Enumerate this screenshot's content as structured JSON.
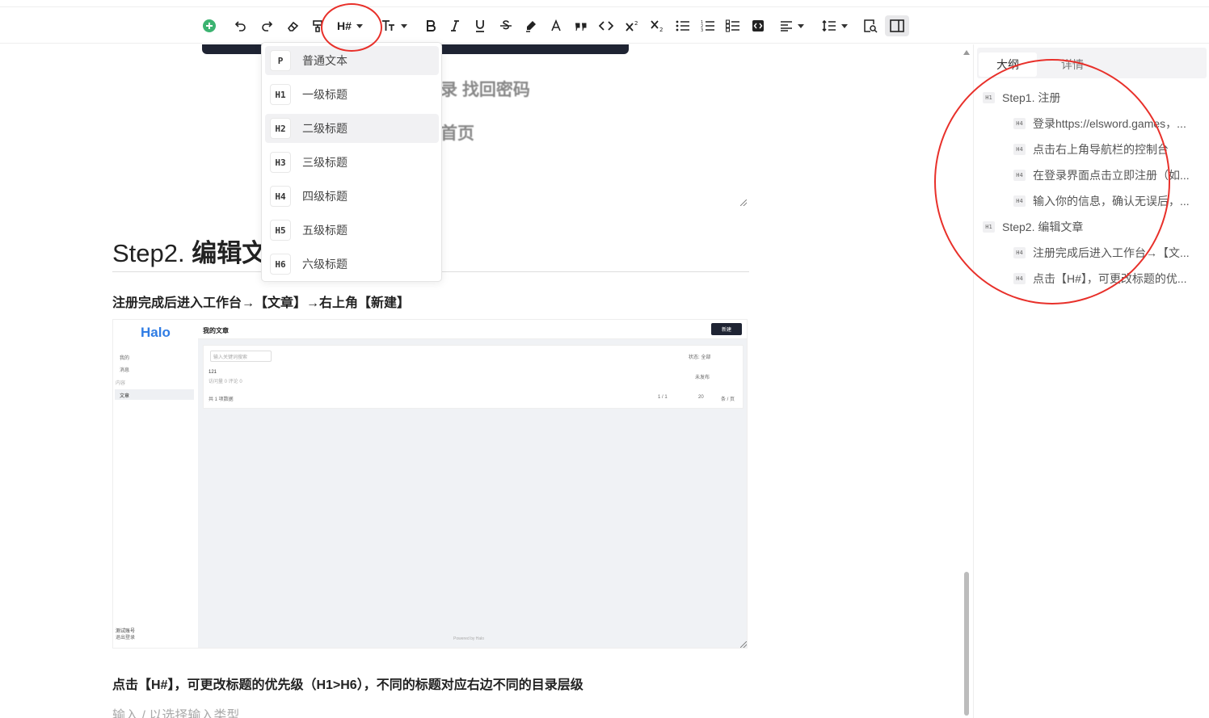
{
  "toolbar": {
    "heading_button_label": "H#"
  },
  "heading_menu": {
    "items": [
      {
        "badge": "P",
        "label": "普通文本"
      },
      {
        "badge": "H1",
        "label": "一级标题"
      },
      {
        "badge": "H2",
        "label": "二级标题"
      },
      {
        "badge": "H3",
        "label": "三级标题"
      },
      {
        "badge": "H4",
        "label": "四级标题"
      },
      {
        "badge": "H5",
        "label": "五级标题"
      },
      {
        "badge": "H6",
        "label": "六级标题"
      }
    ]
  },
  "editor": {
    "partial_text_1": "录  找回密码",
    "partial_text_2": "首页",
    "heading": "Step2. 编辑文章",
    "heading_plain": "Step2. ",
    "heading_bold": "编辑文",
    "para_1": "注册完成后进入工作台→【文章】→右上角【新建】",
    "para_2": "点击【H#】，可更改标题的优先级（H1>H6），不同的标题对应右边不同的目录层级",
    "placeholder": "输入 / 以选择输入类型"
  },
  "embedded_screenshot": {
    "logo": "Halo",
    "page_title": "我的文章",
    "new_button": "新建",
    "search_placeholder": "输入关键词搜索",
    "side_items": [
      "我的",
      "消息",
      "内容",
      "文章"
    ],
    "filter_label": "状态: 全部",
    "row_title": "121",
    "row_meta": "访问量 0  评论 0",
    "row_status": "未发布",
    "total": "共 1 项数据",
    "pager": "1 / 1",
    "page_size": "20",
    "per_page": "条 / 页",
    "footer": "Powered by Halo",
    "user_name": "测试账号",
    "user_sub": "退出登录"
  },
  "outline": {
    "tabs": [
      {
        "label": "大纲",
        "active": true
      },
      {
        "label": "详情",
        "active": false
      }
    ],
    "items": [
      {
        "level": "H1",
        "text": "Step1. 注册"
      },
      {
        "level": "H4",
        "text": "登录https://elsword.games，..."
      },
      {
        "level": "H4",
        "text": "点击右上角导航栏的控制台"
      },
      {
        "level": "H4",
        "text": "在登录界面点击立即注册（如..."
      },
      {
        "level": "H4",
        "text": "输入你的信息，确认无误后，..."
      },
      {
        "level": "H1",
        "text": "Step2. 编辑文章"
      },
      {
        "level": "H4",
        "text": "注册完成后进入工作台→【文..."
      },
      {
        "level": "H4",
        "text": "点击【H#】，可更改标题的优..."
      }
    ]
  },
  "colors": {
    "annotation_red": "#e8302a",
    "add_green": "#3cb371",
    "dark_button": "#1f2433",
    "halo_blue": "#2f7ce4"
  }
}
